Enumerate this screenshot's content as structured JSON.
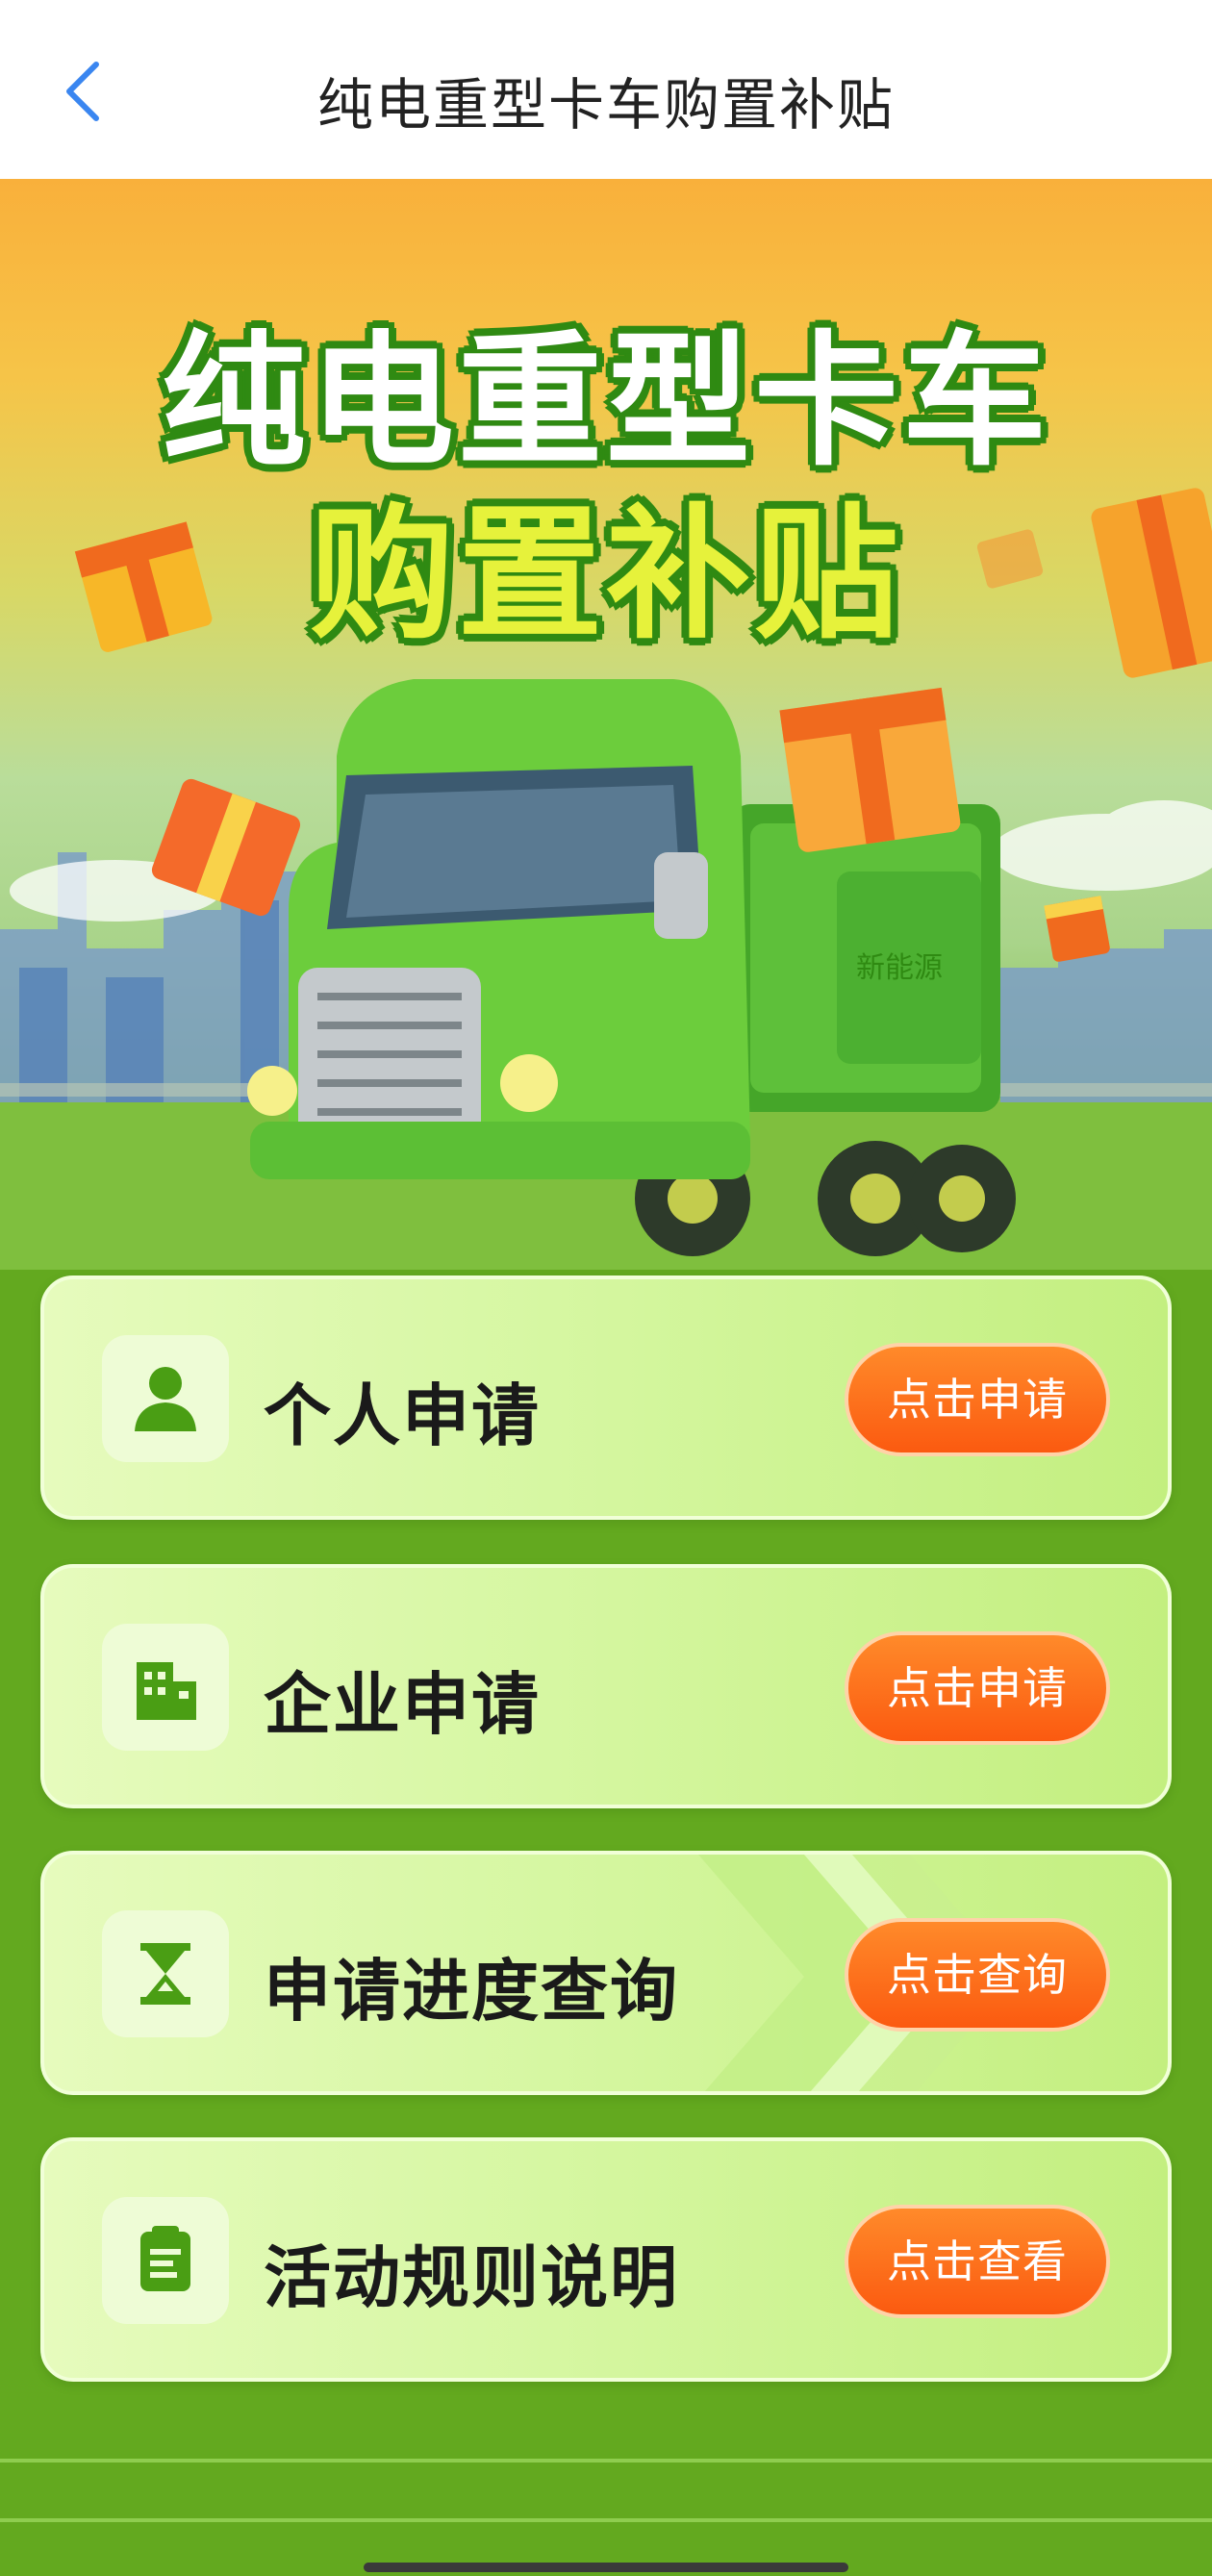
{
  "nav": {
    "title": "纯电重型卡车购置补贴",
    "back_icon": "chevron-left-icon",
    "accent": "#3a86f0"
  },
  "hero": {
    "title_line1": "纯电重型卡车",
    "title_line2": "购置补贴",
    "truck_text": "新能源"
  },
  "menu": {
    "items": [
      {
        "label": "个人申请",
        "icon": "person-icon",
        "button": "点击申请"
      },
      {
        "label": "企业申请",
        "icon": "building-icon",
        "button": "点击申请"
      },
      {
        "label": "申请进度查询",
        "icon": "hourglass-icon",
        "button": "点击查询"
      },
      {
        "label": "活动规则说明",
        "icon": "document-icon",
        "button": "点击查看"
      }
    ]
  },
  "colors": {
    "page_bg": "#63a91f",
    "button_orange": "#fb5a10",
    "icon_green": "#4a9e14"
  }
}
